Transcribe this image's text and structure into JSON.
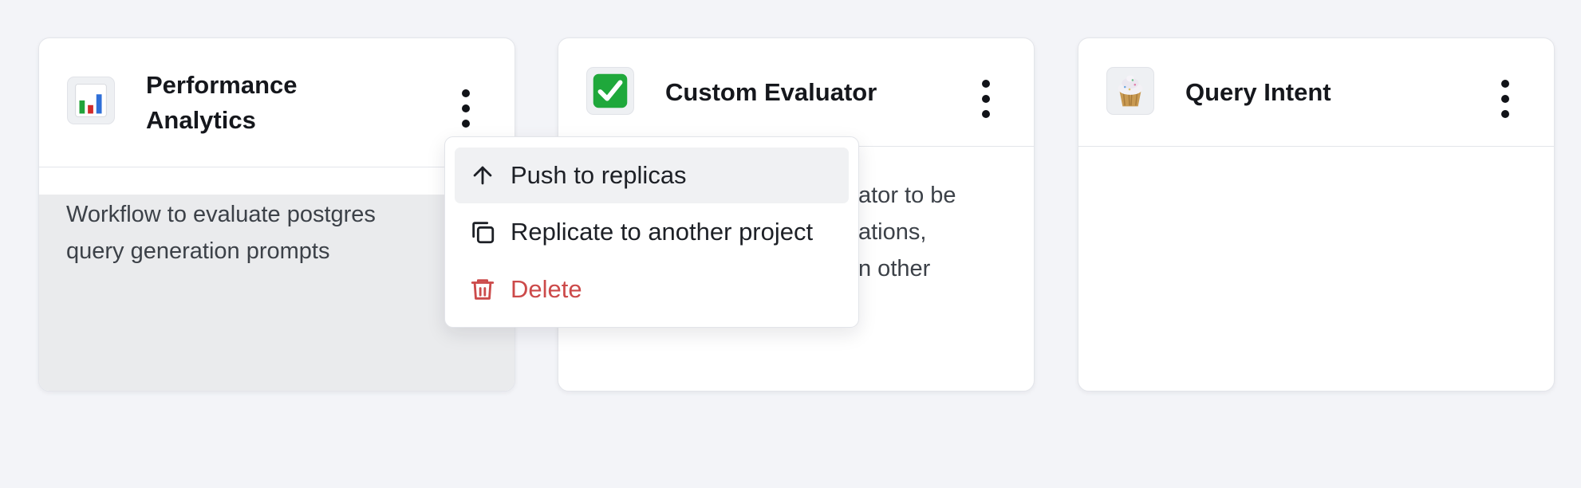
{
  "colors": {
    "page_bg": "#f3f4f8",
    "card_bg": "#ffffff",
    "danger": "#cc4a4a",
    "menu_highlight": "#f0f1f3"
  },
  "cards": [
    {
      "title_line1": "Performance",
      "title_line2": "Analytics",
      "icon": "bar-chart-emoji",
      "desc_line1": "Workflow to evaluate postgres",
      "desc_line2": "query generation prompts"
    },
    {
      "title": "Custom Evaluator",
      "icon": "check-mark-button-emoji",
      "desc_line1": "ator to be",
      "desc_line2": "ations,",
      "desc_line3": "n other"
    },
    {
      "title": "Query Intent",
      "icon": "cupcake-emoji"
    }
  ],
  "menu": {
    "items": [
      {
        "label": "Push to replicas",
        "icon": "arrow-up-icon"
      },
      {
        "label": "Replicate to another project",
        "icon": "copy-icon"
      },
      {
        "label": "Delete",
        "icon": "trash-icon"
      }
    ]
  }
}
